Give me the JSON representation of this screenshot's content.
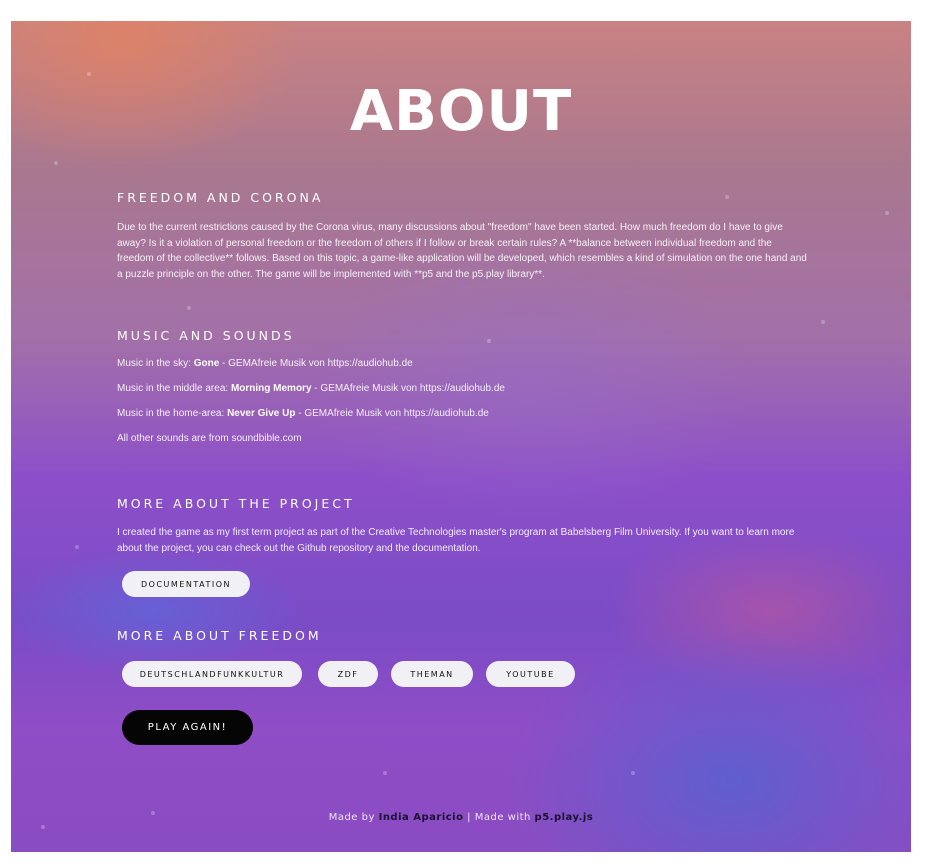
{
  "page": {
    "title": "ABOUT"
  },
  "freedom_section": {
    "heading": "FREEDOM AND CORONA",
    "text": "Due to the current restrictions caused by the Corona virus, many discussions about \"freedom\" have been started. How much freedom do I have to give away? Is it a violation of personal freedom or the freedom of others if I follow or break certain rules? A **balance between individual freedom and the freedom of the collective** follows. Based on this topic, a game-like application will be developed, which resembles a kind of simulation on the one hand and a puzzle principle on the other. The game will be implemented with **p5 and the p5.play library**."
  },
  "music_section": {
    "heading": "MUSIC AND SOUNDS",
    "lines": [
      {
        "prefix": "Music in the sky: ",
        "track": "Gone",
        "suffix": " - GEMAfreie Musik von https://audiohub.de"
      },
      {
        "prefix": "Music in the middle area: ",
        "track": "Morning Memory",
        "suffix": " - GEMAfreie Musik von https://audiohub.de"
      },
      {
        "prefix": "Music in the home-area: ",
        "track": "Never Give Up",
        "suffix": " - GEMAfreie Musik von https://audiohub.de"
      }
    ],
    "other": "All other sounds are from soundbible.com"
  },
  "project_section": {
    "heading": "MORE ABOUT THE PROJECT",
    "text": "I created the game as my first term project as part of the Creative Technologies master's program at Babelsberg Film University. If you want to learn more about the project, you can check out the Github repository and the documentation.",
    "documentation_button": "DOCUMENTATION"
  },
  "freedom_links_section": {
    "heading": "MORE ABOUT FREEDOM",
    "buttons": [
      "DEUTSCHLANDFUNKKULTUR",
      "ZDF",
      "THEMAN",
      "YOUTUBE"
    ]
  },
  "play_again_button": "PLAY AGAIN!",
  "footer": {
    "made_by_prefix": "Made by ",
    "author": "India Aparicio",
    "separator": " | Made with ",
    "tool": "p5.play.js"
  }
}
